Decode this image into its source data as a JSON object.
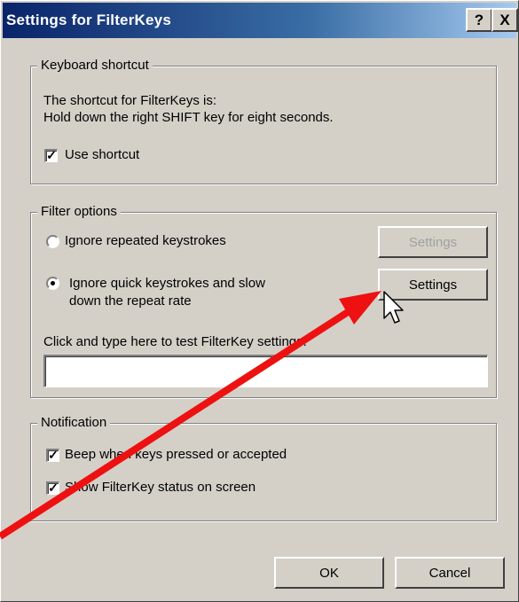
{
  "window": {
    "title": "Settings for FilterKeys"
  },
  "titlebar_buttons": {
    "help": "?",
    "close": "X"
  },
  "keyboard_shortcut": {
    "legend": "Keyboard shortcut",
    "line1": "The shortcut for FilterKeys is:",
    "line2": "Hold down the right SHIFT key for eight seconds.",
    "use_shortcut_label": "Use shortcut",
    "use_shortcut_checked": true
  },
  "filter_options": {
    "legend": "Filter options",
    "option1_label": "Ignore repeated keystrokes",
    "option1_selected": false,
    "option1_settings": "Settings",
    "option2_line1": "Ignore quick keystrokes and slow",
    "option2_line2": "down the repeat rate",
    "option2_selected": true,
    "option2_settings": "Settings",
    "test_label": "Click and type here to test FilterKey settings:",
    "test_value": ""
  },
  "notification": {
    "legend": "Notification",
    "beep_label": "Beep when keys pressed or accepted",
    "beep_checked": true,
    "status_label": "Show FilterKey status on screen",
    "status_checked": true
  },
  "buttons": {
    "ok": "OK",
    "cancel": "Cancel"
  },
  "colors": {
    "title_gradient_start": "#0a246a",
    "title_gradient_end": "#a6caf0",
    "dialog_face": "#d4d0c8",
    "annotation_arrow": "#ee1111"
  },
  "icons": [
    "mouse-pointer-icon",
    "checkmark-icon",
    "annotation-arrow"
  ]
}
